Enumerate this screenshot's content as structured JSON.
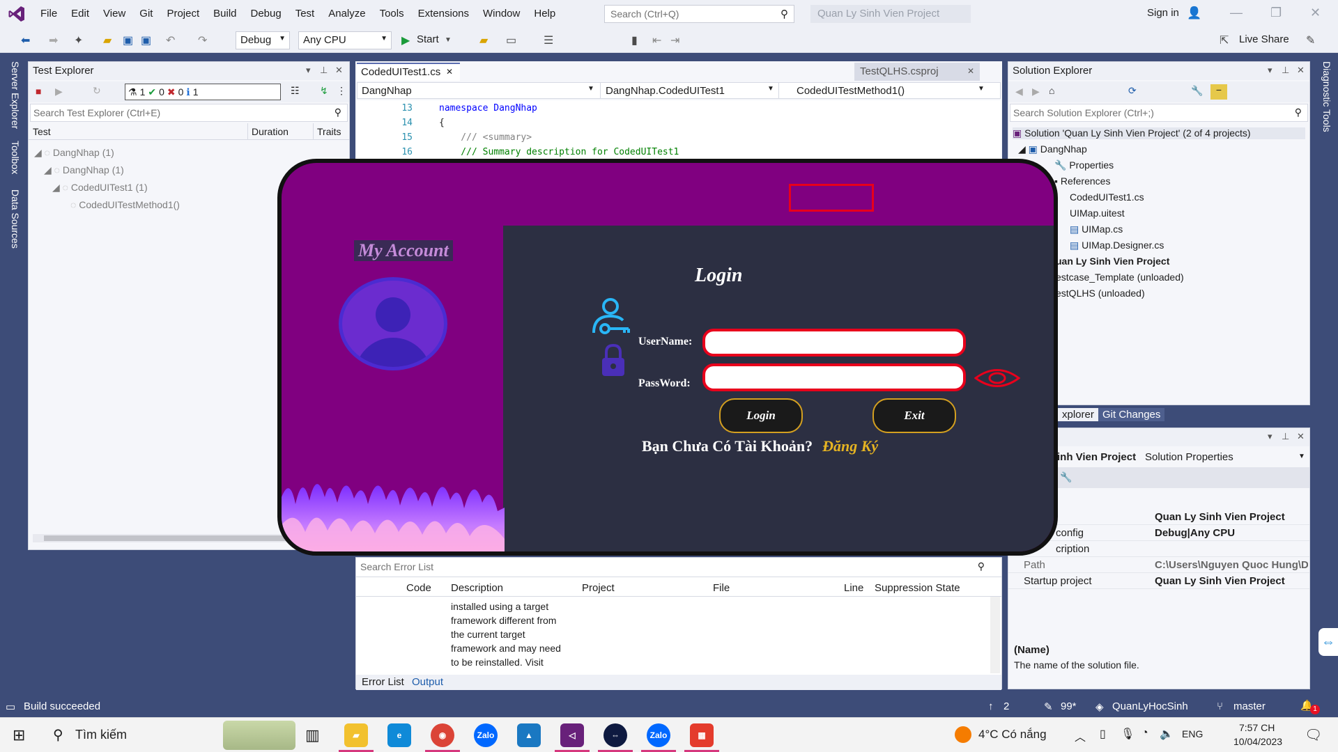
{
  "menu": {
    "items": [
      "File",
      "Edit",
      "View",
      "Git",
      "Project",
      "Build",
      "Debug",
      "Test",
      "Analyze",
      "Tools",
      "Extensions",
      "Window",
      "Help"
    ],
    "search_placeholder": "Search (Ctrl+Q)",
    "project_title": "Quan Ly Sinh Vien Project",
    "sign_in": "Sign in"
  },
  "toolbar": {
    "config": "Debug",
    "platform": "Any CPU",
    "start": "Start",
    "live_share": "Live Share"
  },
  "side_tabs": [
    "Server Explorer",
    "Toolbox",
    "Data Sources"
  ],
  "right_side_tab": "Diagnostic Tools",
  "test_explorer": {
    "title": "Test Explorer",
    "counts": {
      "total": "1",
      "passed": "0",
      "failed": "0",
      "info": "1"
    },
    "search_placeholder": "Search Test Explorer (Ctrl+E)",
    "columns": [
      "Test",
      "Duration",
      "Traits"
    ],
    "tree": [
      {
        "label": "DangNhap  (1)"
      },
      {
        "label": "DangNhap  (1)"
      },
      {
        "label": "CodedUITest1  (1)"
      },
      {
        "label": "CodedUITestMethod1()"
      }
    ]
  },
  "editor": {
    "tab_active": "CodedUITest1.cs",
    "tab_other": "TestQLHS.csproj",
    "nav": [
      "DangNhap",
      "DangNhap.CodedUITest1",
      "CodedUITestMethod1()"
    ],
    "lines": [
      {
        "n": "13",
        "text": "namespace DangNhap"
      },
      {
        "n": "14",
        "text": "{"
      },
      {
        "n": "15",
        "text": "    /// <summary>"
      },
      {
        "n": "16",
        "text": "    /// Summary description for CodedUITest1"
      }
    ]
  },
  "error_list": {
    "search_placeholder": "Search Error List",
    "columns": [
      "Code",
      "Description",
      "Project",
      "File",
      "Line",
      "Suppression State"
    ],
    "description_lines": [
      "installed using a target",
      "framework different from",
      "the current target",
      "framework and may need",
      "to be reinstalled. Visit"
    ],
    "tabs": [
      "Error List",
      "Output"
    ]
  },
  "solution_explorer": {
    "title": "Solution Explorer",
    "search_placeholder": "Search Solution Explorer (Ctrl+;)",
    "items": [
      "Solution 'Quan Ly Sinh Vien Project' (2 of 4 projects)",
      "DangNhap",
      "Properties",
      "References",
      "CodedUITest1.cs",
      "UIMap.uitest",
      "UIMap.cs",
      "UIMap.Designer.cs",
      "uan Ly Sinh Vien Project",
      "estcase_Template (unloaded)",
      "estQLHS (unloaded)"
    ],
    "tabs": [
      "xplorer",
      "Git Changes"
    ]
  },
  "properties": {
    "header_name": "inh Vien Project",
    "header_type": "Solution Properties",
    "rows": [
      {
        "k": "",
        "v": "Quan Ly Sinh Vien Project"
      },
      {
        "k": "config",
        "v": "Debug|Any CPU"
      },
      {
        "k": "cription",
        "v": ""
      },
      {
        "k": "Path",
        "v": "C:\\Users\\Nguyen Quoc Hung\\D"
      },
      {
        "k": "Startup project",
        "v": "Quan Ly Sinh Vien Project"
      }
    ],
    "desc_title": "(Name)",
    "desc_text": "The name of the solution file."
  },
  "login_dialog": {
    "my_account": "My Account",
    "title": "Login",
    "username_label": "UserName:",
    "password_label": "PassWord:",
    "login_btn": "Login",
    "exit_btn": "Exit",
    "no_account": "Bạn Chưa Có Tài Khoản?",
    "register": "Đăng Ký",
    "colors": {
      "bg": "#800080",
      "panel": "#2c2f42",
      "accent": "#e8001c",
      "gold": "#e6b422"
    }
  },
  "status": {
    "left": "Build succeeded",
    "up_count": "2",
    "pencil_count": "99*",
    "repo": "QuanLyHocSinh",
    "branch": "master",
    "notif": "1"
  },
  "taskbar": {
    "search": "Tìm kiếm",
    "weather": "4°C  Có nắng",
    "lang": "ENG",
    "time": "7:57 CH",
    "date": "10/04/2023"
  }
}
